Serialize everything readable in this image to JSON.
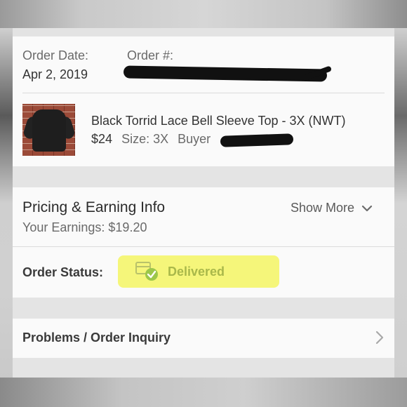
{
  "order": {
    "date_label": "Order Date:",
    "date_value": "Apr 2, 2019",
    "number_label": "Order #:"
  },
  "item": {
    "title": "Black Torrid Lace Bell Sleeve Top - 3X (NWT)",
    "price": "$24",
    "size_label": "Size:",
    "size_value": "3X",
    "buyer_label": "Buyer"
  },
  "pricing": {
    "title": "Pricing & Earning Info",
    "earnings": "Your Earnings: $19.20",
    "show_more": "Show More"
  },
  "status": {
    "label": "Order Status:",
    "value": "Delivered",
    "highlight_color": "#f4f56c",
    "value_color": "#a9b84a",
    "icon": "package-delivered-icon"
  },
  "problems": {
    "label": "Problems / Order Inquiry"
  }
}
